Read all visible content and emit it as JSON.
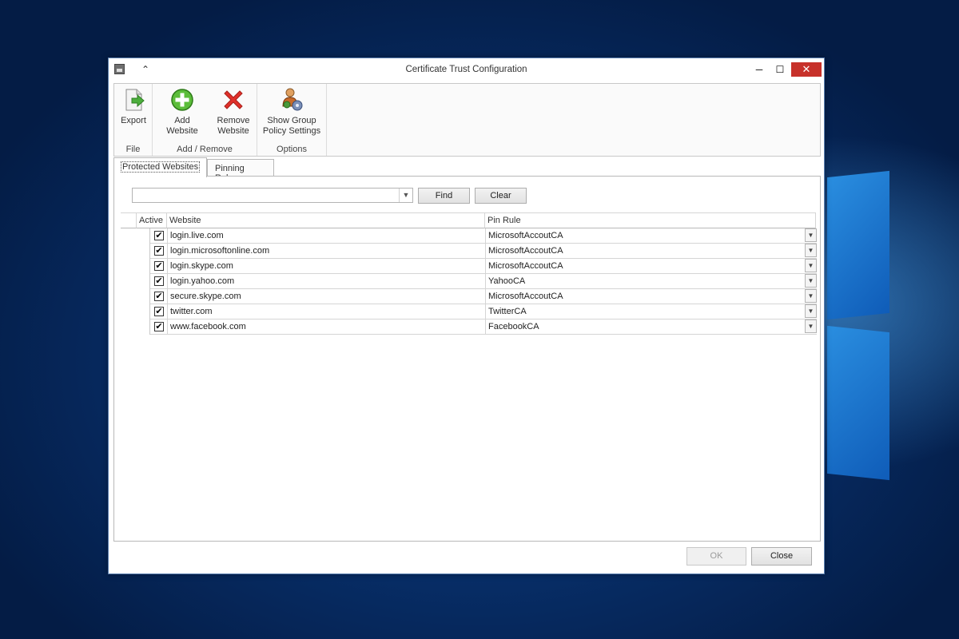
{
  "window": {
    "title": "Certificate Trust Configuration"
  },
  "ribbon": {
    "groups": [
      {
        "label": "File",
        "buttons": [
          {
            "label": "Export",
            "icon": "export-icon"
          }
        ]
      },
      {
        "label": "Add / Remove",
        "buttons": [
          {
            "label": "Add Website",
            "icon": "add-circle-icon"
          },
          {
            "label": "Remove Website",
            "line1": "Remove",
            "line2": "Website",
            "icon": "red-x-icon"
          }
        ]
      },
      {
        "label": "Options",
        "buttons": [
          {
            "label": "Show Group Policy Settings",
            "line1": "Show Group",
            "line2": "Policy Settings",
            "icon": "group-policy-icon"
          }
        ]
      }
    ]
  },
  "tabs": [
    {
      "label": "Protected Websites",
      "selected": true
    },
    {
      "label": "Pinning Rules",
      "selected": false
    }
  ],
  "search": {
    "value": "",
    "find_label": "Find",
    "clear_label": "Clear"
  },
  "grid": {
    "columns": [
      "Active",
      "Website",
      "Pin Rule"
    ],
    "rows": [
      {
        "active": true,
        "website": "login.live.com",
        "pin_rule": "MicrosoftAccoutCA"
      },
      {
        "active": true,
        "website": "login.microsoftonline.com",
        "pin_rule": "MicrosoftAccoutCA"
      },
      {
        "active": true,
        "website": "login.skype.com",
        "pin_rule": "MicrosoftAccoutCA"
      },
      {
        "active": true,
        "website": "login.yahoo.com",
        "pin_rule": "YahooCA"
      },
      {
        "active": true,
        "website": "secure.skype.com",
        "pin_rule": "MicrosoftAccoutCA"
      },
      {
        "active": true,
        "website": "twitter.com",
        "pin_rule": "TwitterCA"
      },
      {
        "active": true,
        "website": "www.facebook.com",
        "pin_rule": "FacebookCA"
      }
    ]
  },
  "footer": {
    "ok_label": "OK",
    "ok_enabled": false,
    "close_label": "Close"
  },
  "colors": {
    "close_window": "#c7312a",
    "desktop": "#0a3f86"
  }
}
